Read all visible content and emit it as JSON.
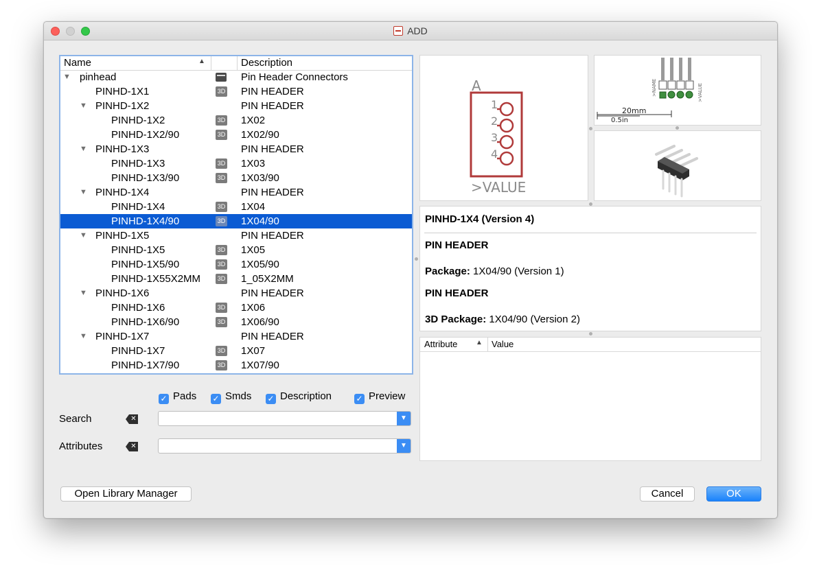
{
  "window": {
    "title": "ADD"
  },
  "tree": {
    "columns": {
      "name": "Name",
      "description": "Description",
      "sort_indicator": "▲"
    },
    "rows": [
      {
        "label": "pinhead",
        "description": "Pin Header Connectors",
        "level": 0,
        "expandable": true,
        "icon": "library-icon"
      },
      {
        "label": "PINHD-1X1",
        "description": "PIN HEADER",
        "level": 1,
        "expandable": false,
        "icon": "3d-icon"
      },
      {
        "label": "PINHD-1X2",
        "description": "PIN HEADER",
        "level": 1,
        "expandable": true,
        "icon": ""
      },
      {
        "label": "PINHD-1X2",
        "description": "1X02",
        "level": 2,
        "expandable": false,
        "icon": "3d-icon"
      },
      {
        "label": "PINHD-1X2/90",
        "description": "1X02/90",
        "level": 2,
        "expandable": false,
        "icon": "3d-icon"
      },
      {
        "label": "PINHD-1X3",
        "description": "PIN HEADER",
        "level": 1,
        "expandable": true,
        "icon": ""
      },
      {
        "label": "PINHD-1X3",
        "description": "1X03",
        "level": 2,
        "expandable": false,
        "icon": "3d-icon"
      },
      {
        "label": "PINHD-1X3/90",
        "description": "1X03/90",
        "level": 2,
        "expandable": false,
        "icon": "3d-icon"
      },
      {
        "label": "PINHD-1X4",
        "description": "PIN HEADER",
        "level": 1,
        "expandable": true,
        "icon": ""
      },
      {
        "label": "PINHD-1X4",
        "description": "1X04",
        "level": 2,
        "expandable": false,
        "icon": "3d-icon"
      },
      {
        "label": "PINHD-1X4/90",
        "description": "1X04/90",
        "level": 2,
        "expandable": false,
        "icon": "3d-icon",
        "selected": true
      },
      {
        "label": "PINHD-1X5",
        "description": "PIN HEADER",
        "level": 1,
        "expandable": true,
        "icon": ""
      },
      {
        "label": "PINHD-1X5",
        "description": "1X05",
        "level": 2,
        "expandable": false,
        "icon": "3d-icon"
      },
      {
        "label": "PINHD-1X5/90",
        "description": "1X05/90",
        "level": 2,
        "expandable": false,
        "icon": "3d-icon"
      },
      {
        "label": "PINHD-1X55X2MM",
        "description": "1_05X2MM",
        "level": 2,
        "expandable": false,
        "icon": "3d-icon"
      },
      {
        "label": "PINHD-1X6",
        "description": "PIN HEADER",
        "level": 1,
        "expandable": true,
        "icon": ""
      },
      {
        "label": "PINHD-1X6",
        "description": "1X06",
        "level": 2,
        "expandable": false,
        "icon": "3d-icon"
      },
      {
        "label": "PINHD-1X6/90",
        "description": "1X06/90",
        "level": 2,
        "expandable": false,
        "icon": "3d-icon"
      },
      {
        "label": "PINHD-1X7",
        "description": "PIN HEADER",
        "level": 1,
        "expandable": true,
        "icon": ""
      },
      {
        "label": "PINHD-1X7",
        "description": "1X07",
        "level": 2,
        "expandable": false,
        "icon": "3d-icon"
      },
      {
        "label": "PINHD-1X7/90",
        "description": "1X07/90",
        "level": 2,
        "expandable": false,
        "icon": "3d-icon"
      }
    ]
  },
  "icon_text": {
    "three_d": "3D"
  },
  "filters": {
    "pads": {
      "label": "Pads",
      "checked": true
    },
    "smds": {
      "label": "Smds",
      "checked": true
    },
    "description": {
      "label": "Description",
      "checked": true
    },
    "preview": {
      "label": "Preview",
      "checked": true
    }
  },
  "search": {
    "label": "Search",
    "value": ""
  },
  "attributes_filter": {
    "label": "Attributes",
    "value": ""
  },
  "symbol_preview": {
    "gate": "A",
    "pins": [
      "1",
      "2",
      "3",
      "4"
    ],
    "value_label": ">VALUE"
  },
  "package_preview": {
    "dimension_mm": "20mm",
    "dimension_in": "0.5in",
    "name_label": ">NAME",
    "value_label": ">VALUE"
  },
  "details": {
    "heading": "PINHD-1X4 (Version 4)",
    "device_description": "PIN HEADER",
    "package_label": "Package:",
    "package_value": "1X04/90 (Version 1)",
    "package_description": "PIN HEADER",
    "package3d_label": "3D Package:",
    "package3d_value": "1X04/90 (Version 2)"
  },
  "attribute_table": {
    "col_attribute": "Attribute",
    "col_value": "Value",
    "sort_indicator": "▲"
  },
  "buttons": {
    "library_manager": "Open Library Manager",
    "cancel": "Cancel",
    "ok": "OK"
  },
  "colors": {
    "selection": "#0b5bd3",
    "symbol": "#b03a3a",
    "accent": "#3b8df4"
  }
}
